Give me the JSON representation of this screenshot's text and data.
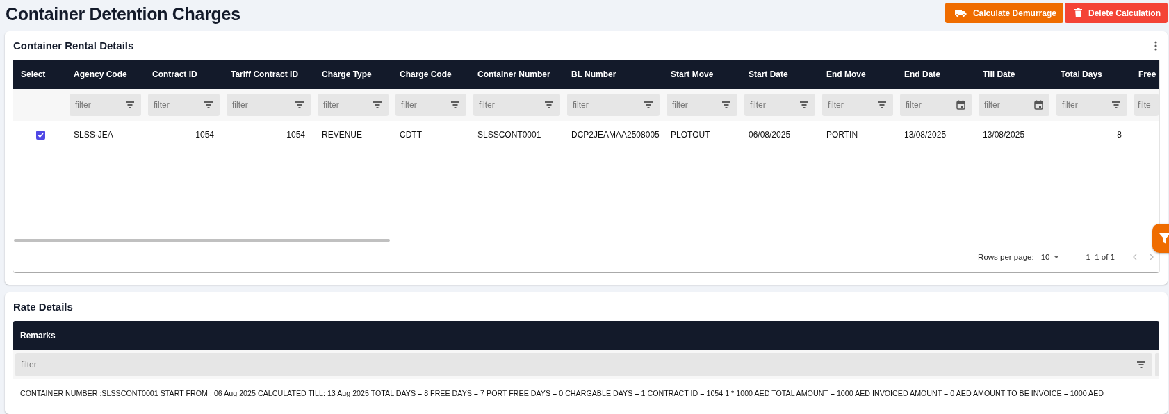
{
  "page": {
    "title": "Container Detention Charges",
    "actions": [
      {
        "label": "Calculate Demurrage",
        "kind": "calculate"
      },
      {
        "label": "Delete Calculation",
        "kind": "delete"
      }
    ]
  },
  "rental": {
    "title": "Container Rental Details",
    "columns": [
      {
        "label": "Select",
        "kind": "select"
      },
      {
        "label": "Agency Code",
        "kind": "text",
        "filter_placeholder": "filter"
      },
      {
        "label": "Contract ID",
        "kind": "number",
        "filter_placeholder": "filter"
      },
      {
        "label": "Tariff Contract ID",
        "kind": "number",
        "filter_placeholder": "filter"
      },
      {
        "label": "Charge Type",
        "kind": "text",
        "filter_placeholder": "filter"
      },
      {
        "label": "Charge Code",
        "kind": "text",
        "filter_placeholder": "filter"
      },
      {
        "label": "Container Number",
        "kind": "text",
        "filter_placeholder": "filter"
      },
      {
        "label": "BL Number",
        "kind": "text",
        "filter_placeholder": "filter"
      },
      {
        "label": "Start Move",
        "kind": "text",
        "filter_placeholder": "filter"
      },
      {
        "label": "Start Date",
        "kind": "text",
        "filter_placeholder": "filter"
      },
      {
        "label": "End Move",
        "kind": "text",
        "filter_placeholder": "filter"
      },
      {
        "label": "End Date",
        "kind": "date",
        "filter_placeholder": "filter"
      },
      {
        "label": "Till Date",
        "kind": "date",
        "filter_placeholder": "filter"
      },
      {
        "label": "Total Days",
        "kind": "number",
        "filter_placeholder": "filter"
      },
      {
        "label": "Free",
        "kind": "clipped",
        "filter_placeholder": "filte"
      }
    ],
    "rows": [
      {
        "selected": true,
        "cells": [
          "",
          "SLSS-JEA",
          "1054",
          "1054",
          "REVENUE",
          "CDTT",
          "SLSSCONT0001",
          "DCP2JEAMAA2508005",
          "PLOTOUT",
          "06/08/2025",
          "PORTIN",
          "13/08/2025",
          "13/08/2025",
          "8",
          ""
        ]
      }
    ],
    "pagination": {
      "rows_per_page_label": "Rows per page:",
      "rows_per_page": "10",
      "range": "1–1 of 1"
    }
  },
  "rate": {
    "title": "Rate Details",
    "column": "Remarks",
    "filter_placeholder": "filter",
    "rows": [
      "CONTAINER NUMBER :SLSSCONT0001 START FROM : 06 Aug 2025 CALCULATED TILL: 13 Aug 2025 TOTAL DAYS = 8 FREE DAYS = 7 PORT FREE DAYS = 0 CHARGABLE DAYS = 1 CONTRACT ID = 1054 1 * 1000 AED TOTAL AMOUNT = 1000 AED INVOICED AMOUNT = 0 AED AMOUNT TO BE INVOICE = 1000 AED"
    ]
  }
}
